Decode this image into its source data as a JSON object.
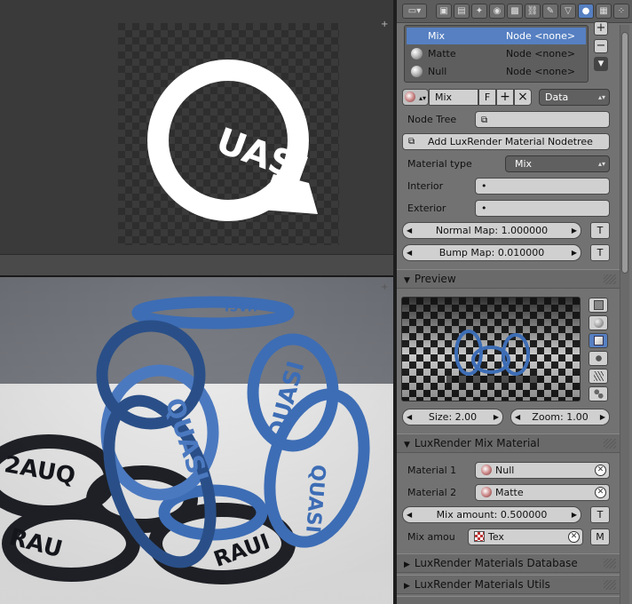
{
  "header_buttons": [
    {
      "icon": "render-icon",
      "glyph": "▣"
    },
    {
      "icon": "render-layers-icon",
      "glyph": "▤"
    },
    {
      "icon": "scene-icon",
      "glyph": "✦"
    },
    {
      "icon": "world-icon",
      "glyph": "◉"
    },
    {
      "icon": "object-icon",
      "glyph": "▩"
    },
    {
      "icon": "constraints-icon",
      "glyph": "⛓"
    },
    {
      "icon": "modifiers-icon",
      "glyph": "✎"
    },
    {
      "icon": "object-data-icon",
      "glyph": "▽"
    },
    {
      "icon": "material-icon",
      "glyph": "●"
    },
    {
      "icon": "texture-icon",
      "glyph": "▦"
    },
    {
      "icon": "particles-icon",
      "glyph": "⁘"
    }
  ],
  "material_slots": [
    {
      "name": "Mix",
      "node": "Node <none>",
      "selected": true
    },
    {
      "name": "Matte",
      "node": "Node <none>",
      "selected": false
    },
    {
      "name": "Null",
      "node": "Node <none>",
      "selected": false
    }
  ],
  "slot_buttons": {
    "add": "+",
    "remove": "−",
    "menu": "▾"
  },
  "material_selector": {
    "name": "Mix",
    "fake_user": "F",
    "add": "+",
    "close": "×",
    "link": "Data"
  },
  "node_tree": {
    "label": "Node Tree",
    "add_button": "Add LuxRender Material Nodetree"
  },
  "material_type": {
    "label": "Material type",
    "value": "Mix"
  },
  "interior": {
    "label": "Interior",
    "value": "•"
  },
  "exterior": {
    "label": "Exterior",
    "value": "•"
  },
  "normal_map": {
    "text": "Normal Map: 1.000000",
    "t": "T"
  },
  "bump_map": {
    "text": "Bump Map: 0.010000",
    "t": "T"
  },
  "preview_panel": {
    "title": "Preview",
    "size": "Size: 2.00",
    "zoom": "Zoom: 1.00",
    "shapes": [
      "flat-icon",
      "sphere-icon",
      "cube-icon",
      "monkey-icon",
      "hair-icon",
      "sphere-array-icon"
    ],
    "active_shape": 2
  },
  "mix_panel": {
    "title": "LuxRender Mix Material",
    "material1_label": "Material 1",
    "material1_value": "Null",
    "material2_label": "Material 2",
    "material2_value": "Matte",
    "mix_amount": "Mix amount: 0.500000",
    "t": "T",
    "mix_tex_label": "Mix amou",
    "mix_tex_value": "Tex",
    "m": "M"
  },
  "collapsed_panels": [
    "LuxRender Materials Database",
    "LuxRender Materials Utils"
  ],
  "texture_image_text": "UASI",
  "render_texts": {
    "a": "QUASI",
    "b": "QUASI",
    "c": "QUASI",
    "d": "UASI",
    "e": "RAUI",
    "f": "2AUQ",
    "g": "RAU"
  },
  "colors": {
    "accent": "#5680c2",
    "panel_bg": "#727272",
    "render_blue": "#3d6db5"
  }
}
